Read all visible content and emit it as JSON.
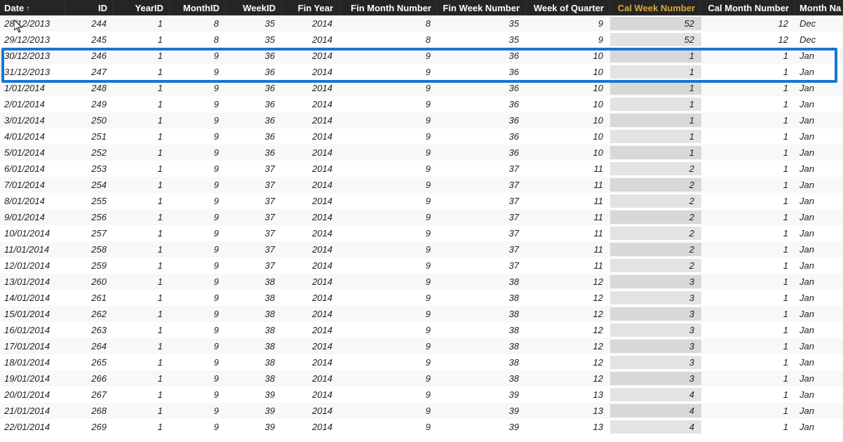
{
  "columns": [
    {
      "key": "date",
      "label": "Date",
      "cls": "c-date",
      "align": "left",
      "sort": true
    },
    {
      "key": "id",
      "label": "ID",
      "cls": "c-id",
      "align": "right"
    },
    {
      "key": "yearid",
      "label": "YearID",
      "cls": "c-year",
      "align": "right"
    },
    {
      "key": "monthid",
      "label": "MonthID",
      "cls": "c-month",
      "align": "right"
    },
    {
      "key": "weekid",
      "label": "WeekID",
      "cls": "c-week",
      "align": "right"
    },
    {
      "key": "fyear",
      "label": "Fin Year",
      "cls": "c-fyear",
      "align": "right"
    },
    {
      "key": "fmonth",
      "label": "Fin Month Number",
      "cls": "c-fmonth",
      "align": "right"
    },
    {
      "key": "fweek",
      "label": "Fin Week Number",
      "cls": "c-fweek",
      "align": "right"
    },
    {
      "key": "woq",
      "label": "Week of Quarter",
      "cls": "c-woq",
      "align": "right"
    },
    {
      "key": "cwn",
      "label": "Cal Week Number",
      "cls": "c-cwn",
      "align": "right",
      "highlightCol": true,
      "shade": true
    },
    {
      "key": "cmn",
      "label": "Cal Month Number",
      "cls": "c-cmn",
      "align": "right"
    },
    {
      "key": "mname",
      "label": "Month Na",
      "cls": "c-mname",
      "align": "left"
    }
  ],
  "rows": [
    {
      "date": "28/12/2013",
      "id": 244,
      "yearid": 1,
      "monthid": 8,
      "weekid": 35,
      "fyear": 2014,
      "fmonth": 8,
      "fweek": 35,
      "woq": 9,
      "cwn": 52,
      "cmn": 12,
      "mname": "Dec"
    },
    {
      "date": "29/12/2013",
      "id": 245,
      "yearid": 1,
      "monthid": 8,
      "weekid": 35,
      "fyear": 2014,
      "fmonth": 8,
      "fweek": 35,
      "woq": 9,
      "cwn": 52,
      "cmn": 12,
      "mname": "Dec"
    },
    {
      "date": "30/12/2013",
      "id": 246,
      "yearid": 1,
      "monthid": 9,
      "weekid": 36,
      "fyear": 2014,
      "fmonth": 9,
      "fweek": 36,
      "woq": 10,
      "cwn": 1,
      "cmn": 1,
      "mname": "Jan"
    },
    {
      "date": "31/12/2013",
      "id": 247,
      "yearid": 1,
      "monthid": 9,
      "weekid": 36,
      "fyear": 2014,
      "fmonth": 9,
      "fweek": 36,
      "woq": 10,
      "cwn": 1,
      "cmn": 1,
      "mname": "Jan"
    },
    {
      "date": "1/01/2014",
      "id": 248,
      "yearid": 1,
      "monthid": 9,
      "weekid": 36,
      "fyear": 2014,
      "fmonth": 9,
      "fweek": 36,
      "woq": 10,
      "cwn": 1,
      "cmn": 1,
      "mname": "Jan"
    },
    {
      "date": "2/01/2014",
      "id": 249,
      "yearid": 1,
      "monthid": 9,
      "weekid": 36,
      "fyear": 2014,
      "fmonth": 9,
      "fweek": 36,
      "woq": 10,
      "cwn": 1,
      "cmn": 1,
      "mname": "Jan"
    },
    {
      "date": "3/01/2014",
      "id": 250,
      "yearid": 1,
      "monthid": 9,
      "weekid": 36,
      "fyear": 2014,
      "fmonth": 9,
      "fweek": 36,
      "woq": 10,
      "cwn": 1,
      "cmn": 1,
      "mname": "Jan"
    },
    {
      "date": "4/01/2014",
      "id": 251,
      "yearid": 1,
      "monthid": 9,
      "weekid": 36,
      "fyear": 2014,
      "fmonth": 9,
      "fweek": 36,
      "woq": 10,
      "cwn": 1,
      "cmn": 1,
      "mname": "Jan"
    },
    {
      "date": "5/01/2014",
      "id": 252,
      "yearid": 1,
      "monthid": 9,
      "weekid": 36,
      "fyear": 2014,
      "fmonth": 9,
      "fweek": 36,
      "woq": 10,
      "cwn": 1,
      "cmn": 1,
      "mname": "Jan"
    },
    {
      "date": "6/01/2014",
      "id": 253,
      "yearid": 1,
      "monthid": 9,
      "weekid": 37,
      "fyear": 2014,
      "fmonth": 9,
      "fweek": 37,
      "woq": 11,
      "cwn": 2,
      "cmn": 1,
      "mname": "Jan"
    },
    {
      "date": "7/01/2014",
      "id": 254,
      "yearid": 1,
      "monthid": 9,
      "weekid": 37,
      "fyear": 2014,
      "fmonth": 9,
      "fweek": 37,
      "woq": 11,
      "cwn": 2,
      "cmn": 1,
      "mname": "Jan"
    },
    {
      "date": "8/01/2014",
      "id": 255,
      "yearid": 1,
      "monthid": 9,
      "weekid": 37,
      "fyear": 2014,
      "fmonth": 9,
      "fweek": 37,
      "woq": 11,
      "cwn": 2,
      "cmn": 1,
      "mname": "Jan"
    },
    {
      "date": "9/01/2014",
      "id": 256,
      "yearid": 1,
      "monthid": 9,
      "weekid": 37,
      "fyear": 2014,
      "fmonth": 9,
      "fweek": 37,
      "woq": 11,
      "cwn": 2,
      "cmn": 1,
      "mname": "Jan"
    },
    {
      "date": "10/01/2014",
      "id": 257,
      "yearid": 1,
      "monthid": 9,
      "weekid": 37,
      "fyear": 2014,
      "fmonth": 9,
      "fweek": 37,
      "woq": 11,
      "cwn": 2,
      "cmn": 1,
      "mname": "Jan"
    },
    {
      "date": "11/01/2014",
      "id": 258,
      "yearid": 1,
      "monthid": 9,
      "weekid": 37,
      "fyear": 2014,
      "fmonth": 9,
      "fweek": 37,
      "woq": 11,
      "cwn": 2,
      "cmn": 1,
      "mname": "Jan"
    },
    {
      "date": "12/01/2014",
      "id": 259,
      "yearid": 1,
      "monthid": 9,
      "weekid": 37,
      "fyear": 2014,
      "fmonth": 9,
      "fweek": 37,
      "woq": 11,
      "cwn": 2,
      "cmn": 1,
      "mname": "Jan"
    },
    {
      "date": "13/01/2014",
      "id": 260,
      "yearid": 1,
      "monthid": 9,
      "weekid": 38,
      "fyear": 2014,
      "fmonth": 9,
      "fweek": 38,
      "woq": 12,
      "cwn": 3,
      "cmn": 1,
      "mname": "Jan"
    },
    {
      "date": "14/01/2014",
      "id": 261,
      "yearid": 1,
      "monthid": 9,
      "weekid": 38,
      "fyear": 2014,
      "fmonth": 9,
      "fweek": 38,
      "woq": 12,
      "cwn": 3,
      "cmn": 1,
      "mname": "Jan"
    },
    {
      "date": "15/01/2014",
      "id": 262,
      "yearid": 1,
      "monthid": 9,
      "weekid": 38,
      "fyear": 2014,
      "fmonth": 9,
      "fweek": 38,
      "woq": 12,
      "cwn": 3,
      "cmn": 1,
      "mname": "Jan"
    },
    {
      "date": "16/01/2014",
      "id": 263,
      "yearid": 1,
      "monthid": 9,
      "weekid": 38,
      "fyear": 2014,
      "fmonth": 9,
      "fweek": 38,
      "woq": 12,
      "cwn": 3,
      "cmn": 1,
      "mname": "Jan"
    },
    {
      "date": "17/01/2014",
      "id": 264,
      "yearid": 1,
      "monthid": 9,
      "weekid": 38,
      "fyear": 2014,
      "fmonth": 9,
      "fweek": 38,
      "woq": 12,
      "cwn": 3,
      "cmn": 1,
      "mname": "Jan"
    },
    {
      "date": "18/01/2014",
      "id": 265,
      "yearid": 1,
      "monthid": 9,
      "weekid": 38,
      "fyear": 2014,
      "fmonth": 9,
      "fweek": 38,
      "woq": 12,
      "cwn": 3,
      "cmn": 1,
      "mname": "Jan"
    },
    {
      "date": "19/01/2014",
      "id": 266,
      "yearid": 1,
      "monthid": 9,
      "weekid": 38,
      "fyear": 2014,
      "fmonth": 9,
      "fweek": 38,
      "woq": 12,
      "cwn": 3,
      "cmn": 1,
      "mname": "Jan"
    },
    {
      "date": "20/01/2014",
      "id": 267,
      "yearid": 1,
      "monthid": 9,
      "weekid": 39,
      "fyear": 2014,
      "fmonth": 9,
      "fweek": 39,
      "woq": 13,
      "cwn": 4,
      "cmn": 1,
      "mname": "Jan"
    },
    {
      "date": "21/01/2014",
      "id": 268,
      "yearid": 1,
      "monthid": 9,
      "weekid": 39,
      "fyear": 2014,
      "fmonth": 9,
      "fweek": 39,
      "woq": 13,
      "cwn": 4,
      "cmn": 1,
      "mname": "Jan"
    },
    {
      "date": "22/01/2014",
      "id": 269,
      "yearid": 1,
      "monthid": 9,
      "weekid": 39,
      "fyear": 2014,
      "fmonth": 9,
      "fweek": 39,
      "woq": 13,
      "cwn": 4,
      "cmn": 1,
      "mname": "Jan"
    }
  ],
  "sortIndicator": "↑"
}
